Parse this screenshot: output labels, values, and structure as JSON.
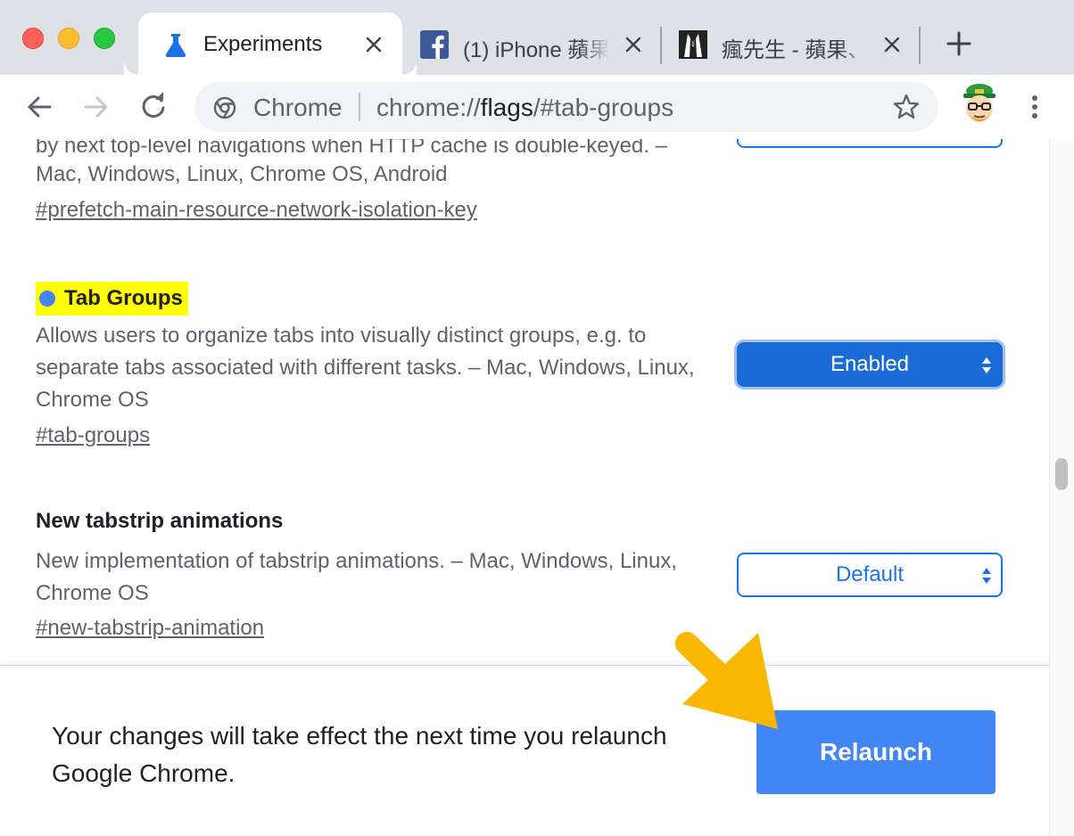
{
  "tabs": [
    {
      "title": "Experiments",
      "icon": "flask-icon",
      "active": true
    },
    {
      "title": "(1) iPhone 蘋果",
      "icon": "facebook-icon",
      "active": false
    },
    {
      "title": "瘋先生 - 蘋果、",
      "icon": "tuxedo-logo-icon",
      "active": false
    }
  ],
  "toolbar": {
    "omnibox_scheme": "Chrome",
    "url_prefix": "chrome://",
    "url_host": "flags",
    "url_path": "/#tab-groups"
  },
  "flags": [
    {
      "partial_description": "by next top-level navigations when HTTP cache is double-keyed. –",
      "description_line2": "Mac, Windows, Linux, Chrome OS, Android",
      "link": "#prefetch-main-resource-network-isolation-key"
    },
    {
      "title": "Tab Groups",
      "description": "Allows users to organize tabs into visually distinct groups, e.g. to separate tabs associated with different tasks. – Mac, Windows, Linux, Chrome OS",
      "link": "#tab-groups",
      "select_value": "Enabled"
    },
    {
      "title": "New tabstrip animations",
      "description": "New implementation of tabstrip animations. – Mac, Windows, Linux, Chrome OS",
      "link": "#new-tabstrip-animation",
      "select_value": "Default"
    }
  ],
  "relaunch": {
    "message": "Your changes will take effect the next time you relaunch Google Chrome.",
    "button_label": "Relaunch"
  },
  "colors": {
    "accent": "#1a73e8",
    "relaunch_button": "#4285f4",
    "highlight": "#ffff00",
    "annotation_arrow": "#f9b700"
  }
}
